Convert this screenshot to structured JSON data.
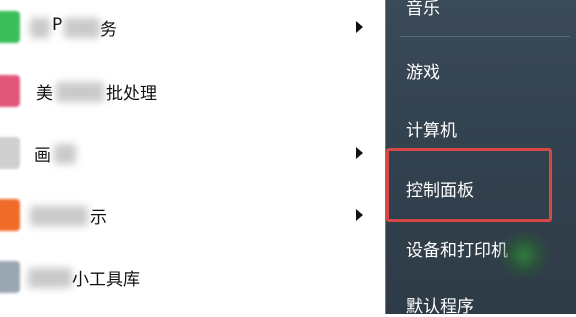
{
  "programs": [
    {
      "prefix": "",
      "text": "P",
      "suffix": "务",
      "has_submenu": true,
      "icon_color": "#3bbf5a"
    },
    {
      "prefix": "美",
      "text": "",
      "suffix": "批处理",
      "has_submenu": false,
      "icon_color": "#e0557a"
    },
    {
      "prefix": "画",
      "text": "",
      "suffix": "",
      "has_submenu": true,
      "icon_color": "#cfcfcf"
    },
    {
      "prefix": "",
      "text": "",
      "suffix": "示",
      "has_submenu": true,
      "icon_color": "#f06a2a"
    },
    {
      "prefix": "",
      "text": "",
      "suffix": "小工具库",
      "has_submenu": false,
      "icon_color": "#9aa7b2"
    }
  ],
  "right_menu": {
    "music": "音乐",
    "games": "游戏",
    "computer": "计算机",
    "control_panel": "控制面板",
    "devices_printers": "设备和打印机",
    "default_programs": "默认程序"
  },
  "colors": {
    "right_pane_bg": "#33424f",
    "highlight_border": "#d64848"
  }
}
